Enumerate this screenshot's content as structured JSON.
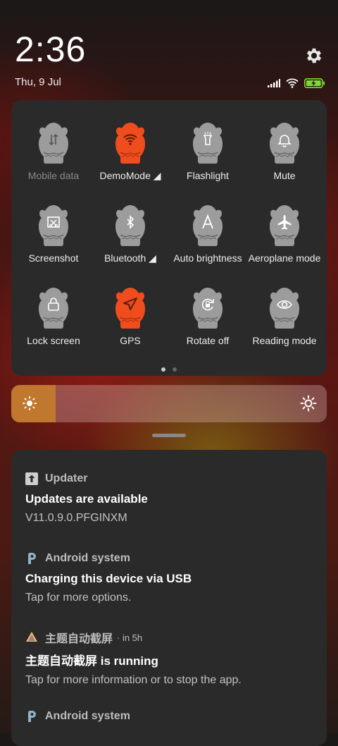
{
  "header": {
    "time": "2:36",
    "date": "Thu, 9 Jul"
  },
  "status": {
    "signal_icon": "signal-icon",
    "wifi_icon": "wifi-icon",
    "battery_icon": "battery-charging-icon",
    "battery_color": "#7ddc2f"
  },
  "colors": {
    "tile_inactive": "#9c9c9c",
    "tile_active": "#ef4d1d",
    "brightness_fill": "#c0782e"
  },
  "quick_tiles": [
    {
      "label": "Mobile data",
      "icon": "mobile-data-icon",
      "active": false,
      "disabled": true
    },
    {
      "label": "DemoMode ◢",
      "icon": "wifi-icon",
      "active": true
    },
    {
      "label": "Flashlight",
      "icon": "flashlight-icon",
      "active": false
    },
    {
      "label": "Mute",
      "icon": "bell-icon",
      "active": false
    },
    {
      "label": "Screenshot",
      "icon": "screenshot-icon",
      "active": false
    },
    {
      "label": "Bluetooth ◢",
      "icon": "bluetooth-icon",
      "active": false
    },
    {
      "label": "Auto brightness",
      "icon": "auto-brightness-icon",
      "active": false
    },
    {
      "label": "Aeroplane mode",
      "icon": "airplane-icon",
      "active": false
    },
    {
      "label": "Lock screen",
      "icon": "lock-icon",
      "active": false
    },
    {
      "label": "GPS",
      "icon": "location-arrow-icon",
      "active": true
    },
    {
      "label": "Rotate off",
      "icon": "rotate-lock-icon",
      "active": false
    },
    {
      "label": "Reading mode",
      "icon": "eye-icon",
      "active": false
    }
  ],
  "pager": {
    "pages": 2,
    "current": 1
  },
  "brightness": {
    "level": 0.14
  },
  "notifications": [
    {
      "app": "Updater",
      "time": "",
      "title": "Updates are available",
      "text": "V11.0.9.0.PFGINXM",
      "icon": "updater-icon"
    },
    {
      "app": "Android system",
      "time": "",
      "title": "Charging this device via USB",
      "text": "Tap for more options.",
      "icon": "android-system-icon"
    },
    {
      "app": "主题自动截屏",
      "time": "· in 5h",
      "title": "主题自动截屏 is running",
      "text": "Tap for more information or to stop the app.",
      "icon": "theme-app-icon"
    },
    {
      "app": "Android system",
      "time": "",
      "title": "",
      "text": "",
      "icon": "android-system-icon"
    }
  ]
}
